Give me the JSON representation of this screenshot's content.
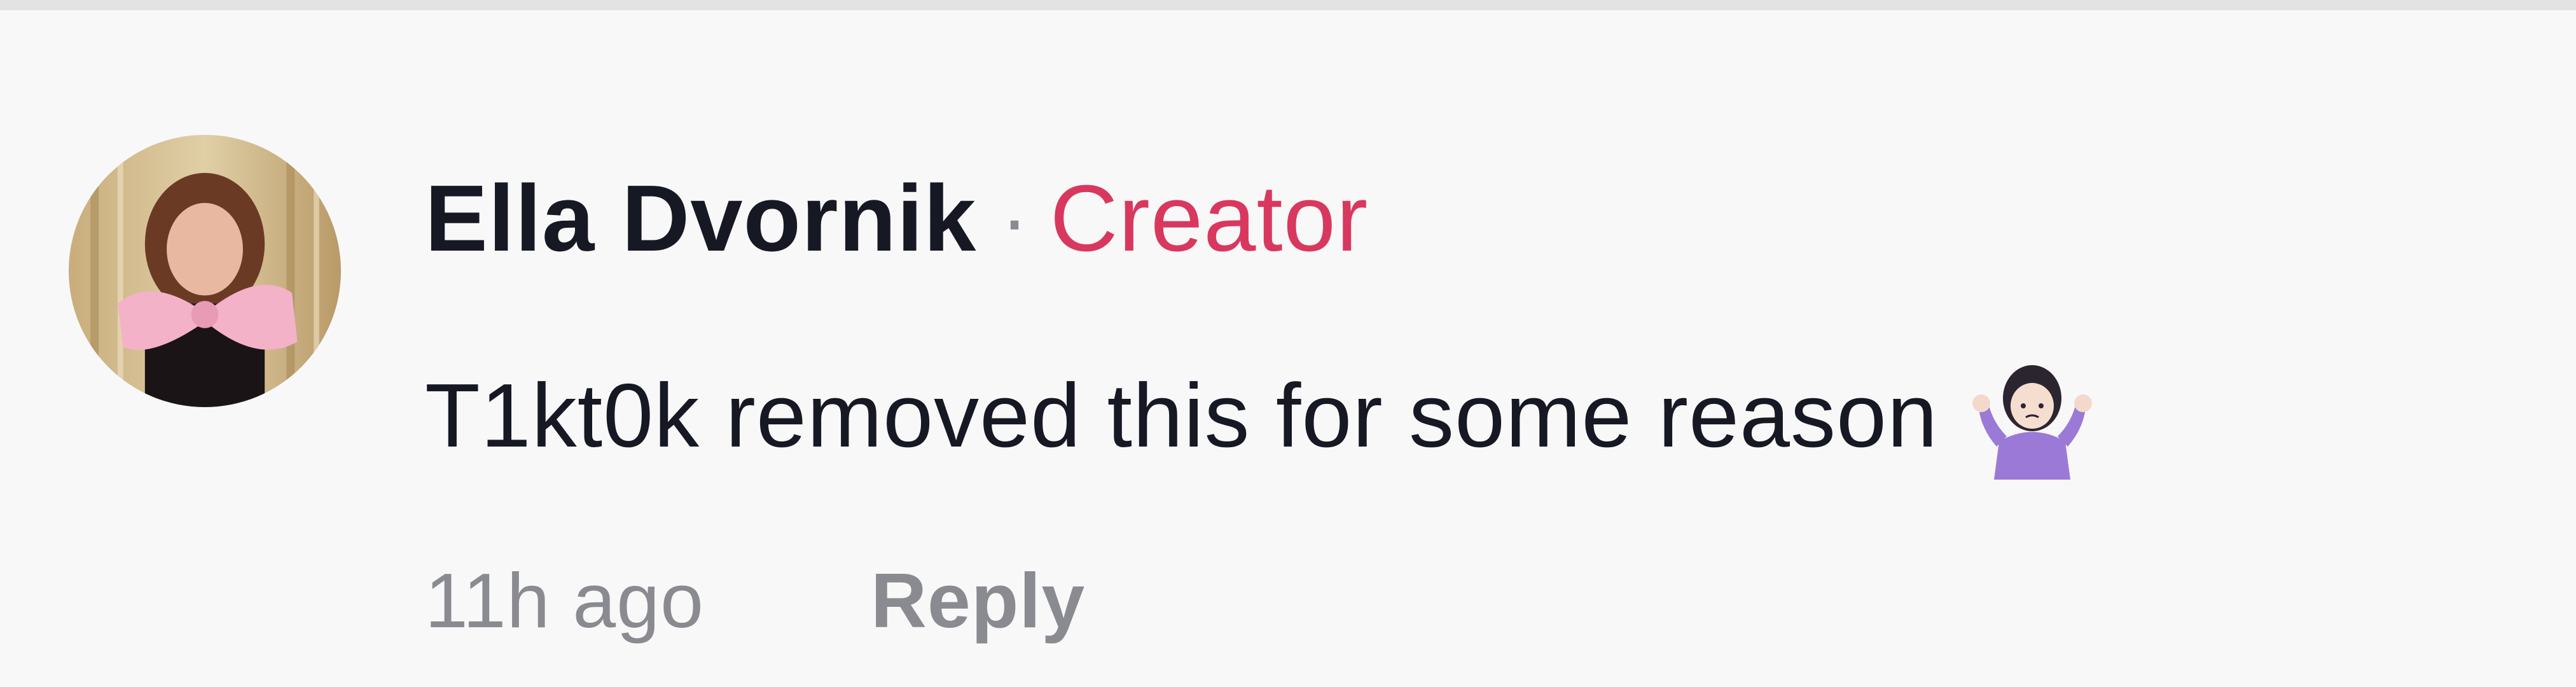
{
  "comment": {
    "author": "Ella Dvornik",
    "separator": "·",
    "badge": "Creator",
    "text": "T1kt0k removed this for some reason",
    "emoji": "shrug-emoji",
    "time": "11h ago",
    "reply_label": "Reply"
  },
  "colors": {
    "background": "#f8f8f8",
    "author": "#161823",
    "badge": "#d9385e",
    "muted": "#8a8b91"
  }
}
